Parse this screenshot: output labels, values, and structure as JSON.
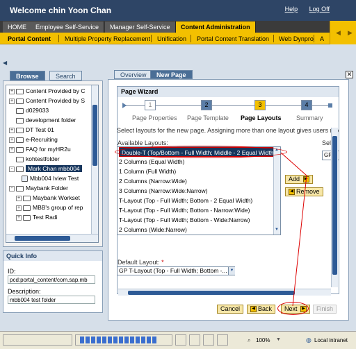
{
  "header": {
    "welcome": "Welcome chin Yoon Chan",
    "help": "Help",
    "logoff": "Log Off"
  },
  "top_nav": [
    "HOME",
    "Employee Self-Service",
    "Manager Self-Service",
    "Content Administration"
  ],
  "sub_nav": [
    "Portal Content",
    "Multiple Property Replacement",
    "Unification",
    "Portal Content Translation",
    "Web Dynpro",
    "A"
  ],
  "left_tabs": [
    "Browse",
    "Search"
  ],
  "tree": [
    {
      "label": "Content Provided by C",
      "sign": "+"
    },
    {
      "label": "Content Provided by S",
      "sign": "+"
    },
    {
      "label": "d029033",
      "sign": ""
    },
    {
      "label": "development folder",
      "sign": ""
    },
    {
      "label": "DT Test 01",
      "sign": "+"
    },
    {
      "label": "e-Recruiting",
      "sign": "+"
    },
    {
      "label": "FAQ for myHR2u",
      "sign": "+"
    },
    {
      "label": "kohtestfolder",
      "sign": ""
    },
    {
      "label": "Mark Chan mbb004",
      "sign": "-"
    },
    {
      "label": "Mbb004 Iview Test",
      "sign": ""
    },
    {
      "label": "Maybank Folder",
      "sign": "-"
    },
    {
      "label": "Maybank Workset",
      "sign": "+"
    },
    {
      "label": "MBB's group of rep",
      "sign": "+"
    },
    {
      "label": "Test Radi",
      "sign": "+"
    }
  ],
  "quick_info": {
    "title": "Quick Info",
    "id_label": "ID:",
    "id_value": "pcd:portal_content/com.sap.mb",
    "desc_label": "Description:",
    "desc_value": "mbb004 test folder"
  },
  "main_tabs": [
    "Overview",
    "New Page"
  ],
  "wizard": {
    "title": "Page Wizard",
    "steps": [
      {
        "num": "1",
        "label": "Page Properties"
      },
      {
        "num": "2",
        "label": "Page Template"
      },
      {
        "num": "3",
        "label": "Page Layouts"
      },
      {
        "num": "4",
        "label": "Summary"
      }
    ],
    "instruction": "Select layouts for the new page. Assigning more than one layout gives users mo",
    "available_label": "Available Layouts:",
    "selected_label": "Sel",
    "selected_value": "GP",
    "layouts": [
      "Double-T (Top/Bottom - Full Width; Middle - 2 Equal Width)",
      "2 Columns (Equal Width)",
      "1 Column (Full Width)",
      "2 Columns (Narrow:Wide)",
      "3 Columns (Narrow:Wide:Narrow)",
      "T-Layout (Top - Full Width; Bottom - 2 Equal Width)",
      "T-Layout (Top - Full Width; Bottom - Narrow:Wide)",
      "T-Layout (Top - Full Width; Bottom - Wide:Narrow)",
      "2 Columns (Wide:Narrow)"
    ],
    "add_label": "Add",
    "remove_label": "Remove",
    "default_label": "Default Layout:",
    "required_mark": "*",
    "default_value": "GP T-Layout (Top - Full Width; Bottom -...",
    "buttons": {
      "cancel": "Cancel",
      "back": "Back",
      "next": "Next",
      "finish": "Finish"
    }
  },
  "status": {
    "zoom": "100%",
    "zone": "Local intranet"
  },
  "colors": {
    "accent": "#f3c000",
    "brand_dark": "#2e4566",
    "selection": "#17365d",
    "annotation": "#d00000"
  }
}
